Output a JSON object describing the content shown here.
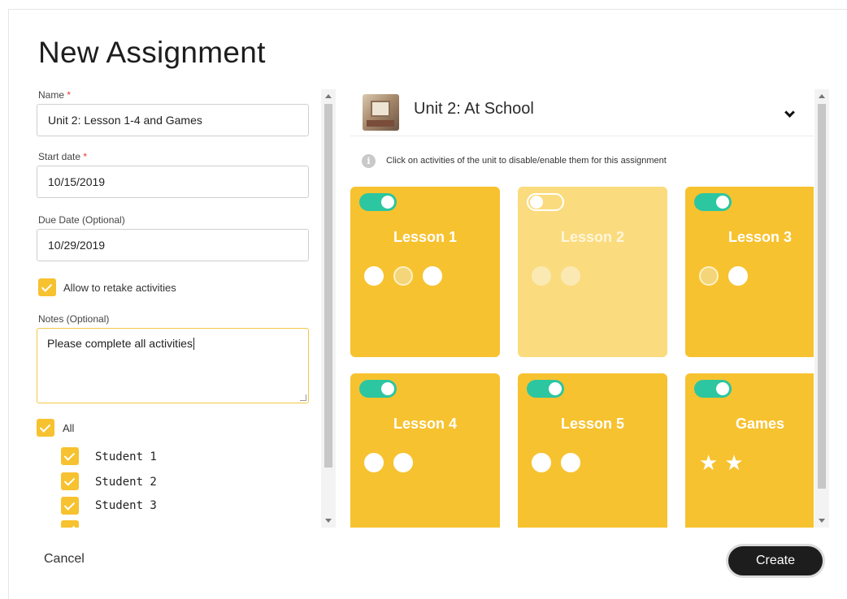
{
  "page": {
    "title": "New Assignment"
  },
  "form": {
    "name_label": "Name",
    "name_required": "*",
    "name_value": "Unit 2: Lesson 1-4 and Games",
    "start_label": "Start date",
    "start_required": "*",
    "start_value": "10/15/2019",
    "due_label": "Due Date (Optional)",
    "due_value": "10/29/2019",
    "retake_label": "Allow to retake activities",
    "notes_label": "Notes (Optional)",
    "notes_value": "Please complete all activities",
    "all_label": "All",
    "students": [
      "Student 1",
      "Student 2",
      "Student 3"
    ]
  },
  "unit": {
    "title": "Unit 2: At School",
    "info_text": "Click on activities of the unit to disable/enable them for this assignment",
    "lessons": [
      {
        "title": "Lesson 1",
        "enabled": true
      },
      {
        "title": "Lesson 2",
        "enabled": false
      },
      {
        "title": "Lesson 3",
        "enabled": true
      },
      {
        "title": "Lesson 4",
        "enabled": true
      },
      {
        "title": "Lesson 5",
        "enabled": true
      },
      {
        "title": "Games",
        "enabled": true
      }
    ]
  },
  "actions": {
    "cancel_label": "Cancel",
    "create_label": "Create"
  },
  "colors": {
    "card": "#f7c22f",
    "card_disabled": "#fadb7e",
    "toggle_on": "#2cc6a0",
    "button_dark": "#1d1d1d"
  },
  "icons": [
    "chevron-down-icon",
    "info-icon",
    "check-icon",
    "star-icon"
  ]
}
